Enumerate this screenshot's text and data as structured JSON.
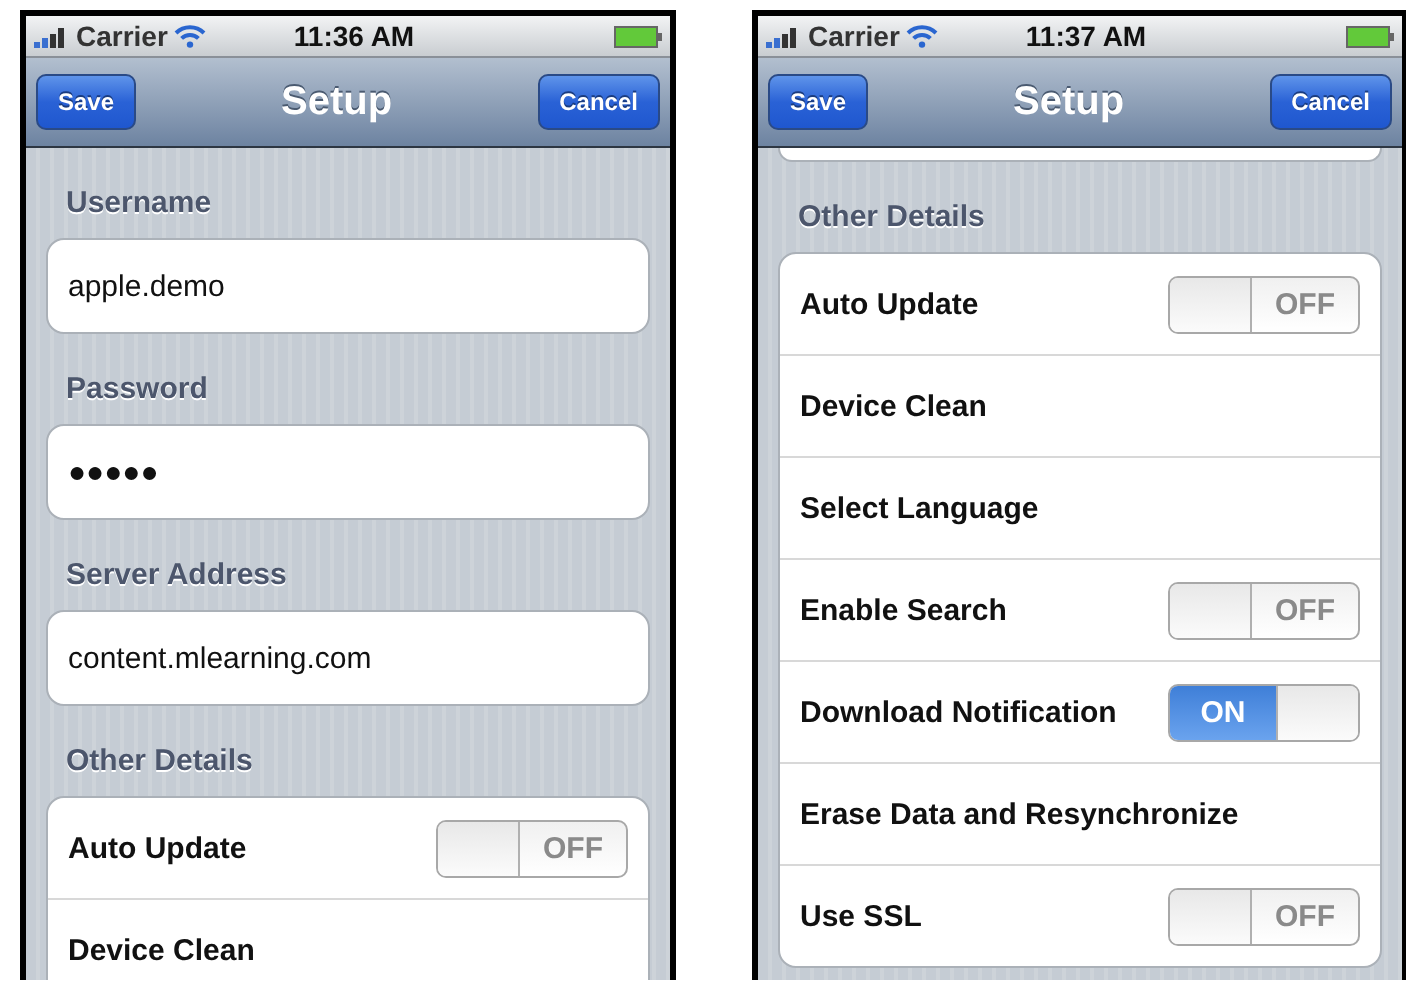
{
  "screens": [
    {
      "status_bar": {
        "carrier": "Carrier",
        "time": "11:36 AM"
      },
      "nav": {
        "left_button": "Save",
        "title": "Setup",
        "right_button": "Cancel"
      },
      "top_card_edge": false,
      "sections": [
        {
          "header": "Username",
          "kind": "field",
          "value": "apple.demo"
        },
        {
          "header": "Password",
          "kind": "field",
          "value": "●●●●●"
        },
        {
          "header": "Server Address",
          "kind": "field",
          "value": "content.mlearning.com"
        },
        {
          "header": "Other Details",
          "kind": "group",
          "rows": [
            {
              "label": "Auto Update",
              "kind": "switch",
              "on": false,
              "switch_text": "OFF"
            },
            {
              "label": "Device Clean",
              "kind": "plain"
            }
          ]
        }
      ]
    },
    {
      "status_bar": {
        "carrier": "Carrier",
        "time": "11:37 AM"
      },
      "nav": {
        "left_button": "Save",
        "title": "Setup",
        "right_button": "Cancel"
      },
      "top_card_edge": true,
      "sections": [
        {
          "header": "Other Details",
          "kind": "group",
          "rows": [
            {
              "label": "Auto Update",
              "kind": "switch",
              "on": false,
              "switch_text": "OFF"
            },
            {
              "label": "Device Clean",
              "kind": "plain"
            },
            {
              "label": "Select Language",
              "kind": "plain"
            },
            {
              "label": "Enable Search",
              "kind": "switch",
              "on": false,
              "switch_text": "OFF"
            },
            {
              "label": "Download Notification",
              "kind": "switch",
              "on": true,
              "switch_text": "ON"
            },
            {
              "label": "Erase Data and Resynchronize",
              "kind": "plain"
            },
            {
              "label": "Use SSL",
              "kind": "switch",
              "on": false,
              "switch_text": "OFF"
            }
          ]
        }
      ]
    }
  ]
}
